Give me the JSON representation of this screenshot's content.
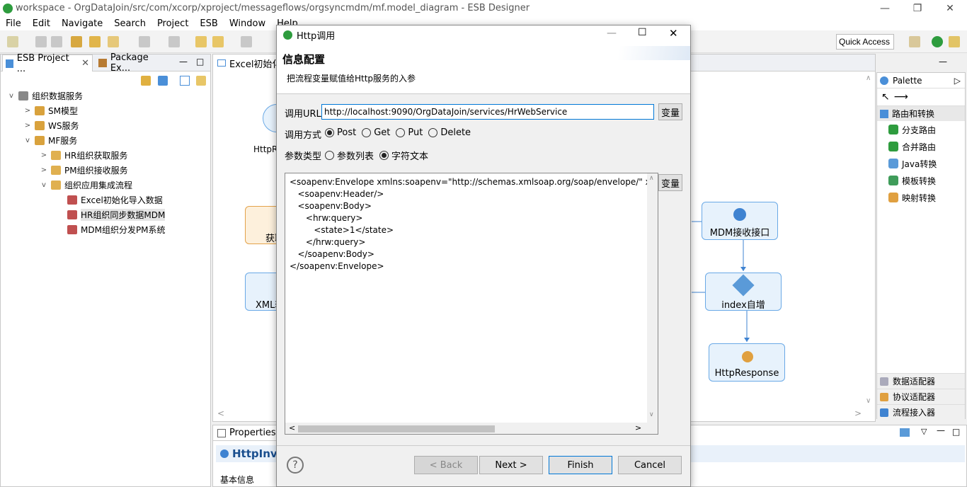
{
  "window": {
    "title": "workspace - OrgDataJoin/src/com/xcorp/xproject/messageflows/orgsyncmdm/mf.model_diagram - ESB Designer"
  },
  "menu": [
    "File",
    "Edit",
    "Navigate",
    "Search",
    "Project",
    "ESB",
    "Window",
    "Help"
  ],
  "toolbar": {
    "quick_access": "Quick Access"
  },
  "left_tabs": [
    "ESB Project ...",
    "Package Ex..."
  ],
  "tree": [
    {
      "label": "组织数据服务",
      "level": 0,
      "chevron": "v"
    },
    {
      "label": "SM模型",
      "level": 1,
      "chevron": ">"
    },
    {
      "label": "WS服务",
      "level": 1,
      "chevron": ">"
    },
    {
      "label": "MF服务",
      "level": 1,
      "chevron": "v"
    },
    {
      "label": "HR组织获取服务",
      "level": 2,
      "chevron": ">"
    },
    {
      "label": "PM组织接收服务",
      "level": 2,
      "chevron": ">"
    },
    {
      "label": "组织应用集成流程",
      "level": 2,
      "chevron": "v"
    },
    {
      "label": "Excel初始化导入数据",
      "level": 3,
      "chevron": ""
    },
    {
      "label": "HR组织同步数据MDM",
      "level": 3,
      "chevron": "",
      "selected": true
    },
    {
      "label": "MDM组织分发PM系统",
      "level": 3,
      "chevron": ""
    }
  ],
  "editor": {
    "tab": "Excel初始化",
    "nodes": {
      "left1": "HttpR",
      "left2": "获取",
      "left3": "XML转",
      "mdm": "MDM接收接口",
      "index": "index自增",
      "resp": "HttpResponse"
    }
  },
  "palette": {
    "title": "Palette",
    "group": "路由和转换",
    "items": [
      "分支路由",
      "合并路由",
      "Java转换",
      "模板转换",
      "映射转换"
    ],
    "bottom_groups": [
      "数据适配器",
      "协议适配器",
      "流程接入器"
    ]
  },
  "properties": {
    "tab": "Properties",
    "title": "HttpInv",
    "section": "基本信息"
  },
  "dialog": {
    "title": "Http调用",
    "heading": "信息配置",
    "description": "把流程变量赋值给Http服务的入参",
    "url_label": "调用URL",
    "url_value": "http://localhost:9090/OrgDataJoin/services/HrWebService",
    "var_button": "变量",
    "method_label": "调用方式",
    "methods": [
      "Post",
      "Get",
      "Put",
      "Delete"
    ],
    "param_label": "参数类型",
    "param_types": [
      "参数列表",
      "字符文本"
    ],
    "code": "<soapenv:Envelope xmlns:soapenv=\"http://schemas.xmlsoap.org/soap/envelope/\" xm\n   <soapenv:Header/>\n   <soapenv:Body>\n      <hrw:query>\n         <state>1</state>\n      </hrw:query>\n   </soapenv:Body>\n</soapenv:Envelope>",
    "buttons": {
      "back": "< Back",
      "next": "Next >",
      "finish": "Finish",
      "cancel": "Cancel"
    },
    "help": "?"
  },
  "colors": {
    "accent": "#0078d7",
    "node_border": "#6aa9e6",
    "node_fill": "#e7f2fc"
  }
}
